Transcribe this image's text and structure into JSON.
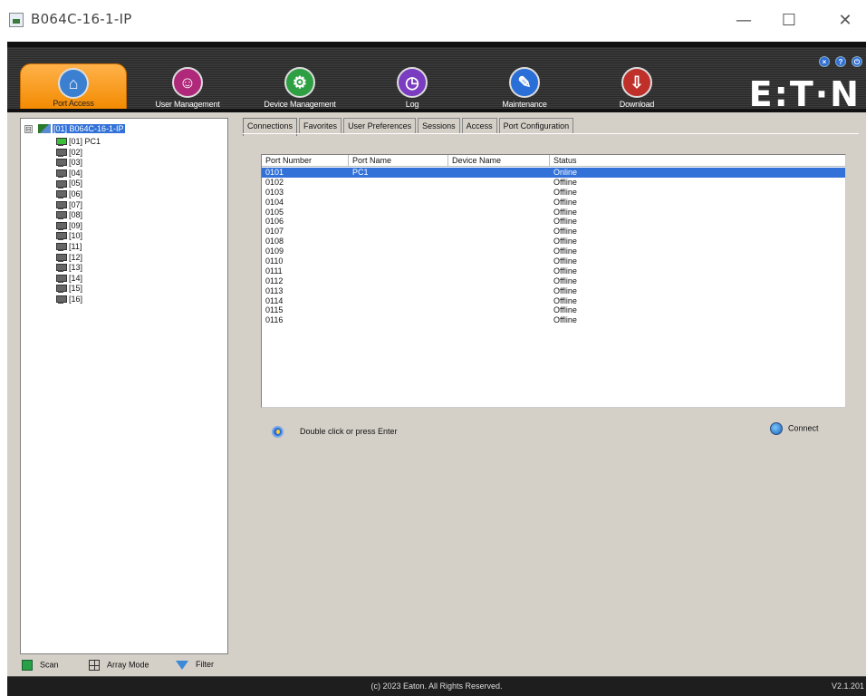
{
  "window": {
    "title": "B064C-16-1-IP",
    "minimize_glyph": "—",
    "maximize_glyph": "☐",
    "close_glyph": "✕"
  },
  "header": {
    "nav": [
      {
        "label": "Port Access",
        "icon": "port-access-icon",
        "color": "#3a7fd0",
        "active": true
      },
      {
        "label": "User Management",
        "icon": "user-management-icon",
        "color": "#b0287a"
      },
      {
        "label": "Device Management",
        "icon": "device-management-icon",
        "color": "#2ea043"
      },
      {
        "label": "Log",
        "icon": "log-icon",
        "color": "#7a3cc0"
      },
      {
        "label": "Maintenance",
        "icon": "maintenance-icon",
        "color": "#2a6fd8"
      },
      {
        "label": "Download",
        "icon": "download-icon",
        "color": "#c0302a"
      }
    ],
    "top_icons": [
      "x-icon",
      "help-icon",
      "logout-icon"
    ],
    "logo": "E:T·N"
  },
  "tree": {
    "expander": "⊟",
    "root_label": "[01] B064C-16-1-IP",
    "items": [
      {
        "label": "[01] PC1",
        "online": true
      },
      {
        "label": "[02]",
        "online": false
      },
      {
        "label": "[03]",
        "online": false
      },
      {
        "label": "[04]",
        "online": false
      },
      {
        "label": "[05]",
        "online": false
      },
      {
        "label": "[06]",
        "online": false
      },
      {
        "label": "[07]",
        "online": false
      },
      {
        "label": "[08]",
        "online": false
      },
      {
        "label": "[09]",
        "online": false
      },
      {
        "label": "[10]",
        "online": false
      },
      {
        "label": "[11]",
        "online": false
      },
      {
        "label": "[12]",
        "online": false
      },
      {
        "label": "[13]",
        "online": false
      },
      {
        "label": "[14]",
        "online": false
      },
      {
        "label": "[15]",
        "online": false
      },
      {
        "label": "[16]",
        "online": false
      }
    ],
    "footer": {
      "scan": "Scan",
      "array_mode": "Array Mode",
      "filter": "Filter"
    }
  },
  "tabs": [
    {
      "label": "Connections",
      "active": true
    },
    {
      "label": "Favorites"
    },
    {
      "label": "User Preferences"
    },
    {
      "label": "Sessions"
    },
    {
      "label": "Access"
    },
    {
      "label": "Port Configuration"
    }
  ],
  "table": {
    "headers": [
      "Port Number",
      "Port Name",
      "Device Name",
      "Status"
    ],
    "rows": [
      {
        "port": "0101",
        "name": "PC1",
        "device": "",
        "status": "Online",
        "selected": true
      },
      {
        "port": "0102",
        "name": "",
        "device": "",
        "status": "Offline"
      },
      {
        "port": "0103",
        "name": "",
        "device": "",
        "status": "Offline"
      },
      {
        "port": "0104",
        "name": "",
        "device": "",
        "status": "Offline"
      },
      {
        "port": "0105",
        "name": "",
        "device": "",
        "status": "Offline"
      },
      {
        "port": "0106",
        "name": "",
        "device": "",
        "status": "Offline"
      },
      {
        "port": "0107",
        "name": "",
        "device": "",
        "status": "Offline"
      },
      {
        "port": "0108",
        "name": "",
        "device": "",
        "status": "Offline"
      },
      {
        "port": "0109",
        "name": "",
        "device": "",
        "status": "Offline"
      },
      {
        "port": "0110",
        "name": "",
        "device": "",
        "status": "Offline"
      },
      {
        "port": "0111",
        "name": "",
        "device": "",
        "status": "Offline"
      },
      {
        "port": "0112",
        "name": "",
        "device": "",
        "status": "Offline"
      },
      {
        "port": "0113",
        "name": "",
        "device": "",
        "status": "Offline"
      },
      {
        "port": "0114",
        "name": "",
        "device": "",
        "status": "Offline"
      },
      {
        "port": "0115",
        "name": "",
        "device": "",
        "status": "Offline"
      },
      {
        "port": "0116",
        "name": "",
        "device": "",
        "status": "Offline"
      }
    ]
  },
  "hint": "Double click or press Enter",
  "connect_label": "Connect",
  "footer": {
    "copyright": "(c) 2023 Eaton. All Rights Reserved.",
    "version": "V2.1.201"
  }
}
